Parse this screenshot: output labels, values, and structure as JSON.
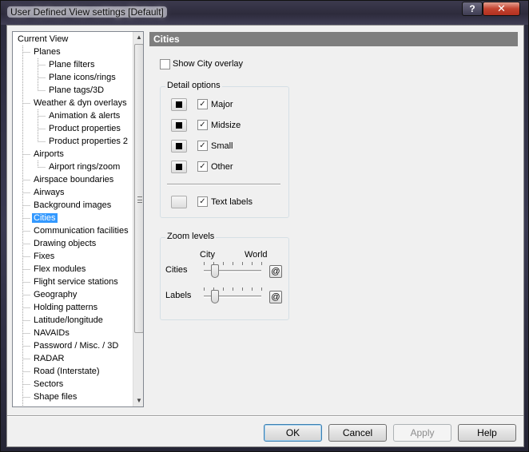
{
  "window": {
    "title": "User Defined View settings  [Default]",
    "help_glyph": "?",
    "close_glyph": "✕"
  },
  "tree": {
    "items": [
      {
        "label": "Current View",
        "level": 0
      },
      {
        "label": "Planes",
        "level": 1
      },
      {
        "label": "Plane filters",
        "level": 2
      },
      {
        "label": "Plane icons/rings",
        "level": 2
      },
      {
        "label": "Plane tags/3D",
        "level": 2
      },
      {
        "label": "Weather & dyn overlays",
        "level": 1
      },
      {
        "label": "Animation & alerts",
        "level": 2
      },
      {
        "label": "Product properties",
        "level": 2
      },
      {
        "label": "Product properties 2",
        "level": 2
      },
      {
        "label": "Airports",
        "level": 1
      },
      {
        "label": "Airport rings/zoom",
        "level": 2
      },
      {
        "label": "Airspace boundaries",
        "level": 1
      },
      {
        "label": "Airways",
        "level": 1
      },
      {
        "label": "Background images",
        "level": 1
      },
      {
        "label": "Cities",
        "level": 1,
        "selected": true
      },
      {
        "label": "Communication facilities",
        "level": 1
      },
      {
        "label": "Drawing objects",
        "level": 1
      },
      {
        "label": "Fixes",
        "level": 1
      },
      {
        "label": "Flex modules",
        "level": 1
      },
      {
        "label": "Flight service stations",
        "level": 1
      },
      {
        "label": "Geography",
        "level": 1
      },
      {
        "label": "Holding patterns",
        "level": 1
      },
      {
        "label": "Latitude/longitude",
        "level": 1
      },
      {
        "label": "NAVAIDs",
        "level": 1
      },
      {
        "label": "Password / Misc. / 3D",
        "level": 1
      },
      {
        "label": "RADAR",
        "level": 1
      },
      {
        "label": "Road (Interstate)",
        "level": 1
      },
      {
        "label": "Sectors",
        "level": 1
      },
      {
        "label": "Shape files",
        "level": 1
      }
    ]
  },
  "panel": {
    "header": "Cities",
    "show_overlay": {
      "label": "Show City overlay",
      "checked": false
    },
    "detail_options": {
      "title": "Detail options",
      "items": [
        {
          "label": "Major",
          "checked": true,
          "color": "#000000"
        },
        {
          "label": "Midsize",
          "checked": true,
          "color": "#000000"
        },
        {
          "label": "Small",
          "checked": true,
          "color": "#000000"
        },
        {
          "label": "Other",
          "checked": true,
          "color": "#000000"
        }
      ],
      "text_labels": {
        "label": "Text labels",
        "checked": true,
        "color": "#ffffff"
      }
    },
    "zoom_levels": {
      "title": "Zoom levels",
      "col_left": "City",
      "col_right": "World",
      "sliders": [
        {
          "label": "Cities",
          "value_fraction": 0.2,
          "button": "@"
        },
        {
          "label": "Labels",
          "value_fraction": 0.2,
          "button": "@"
        }
      ]
    }
  },
  "buttons": {
    "ok": "OK",
    "cancel": "Cancel",
    "apply": "Apply",
    "help": "Help"
  },
  "scroll": {
    "up": "▲",
    "down": "▼"
  },
  "check_glyph": "✓"
}
